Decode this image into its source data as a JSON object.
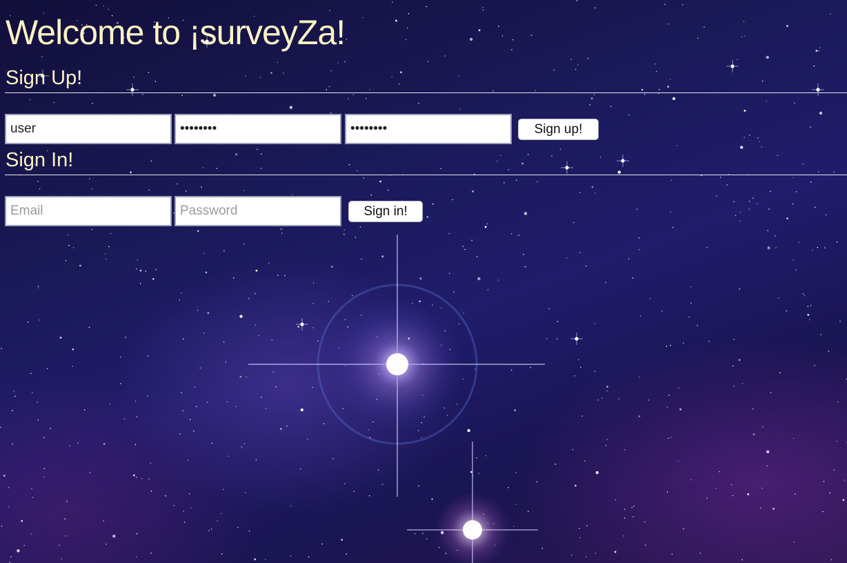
{
  "page": {
    "title": "Welcome to ¡surveyZa!"
  },
  "signup": {
    "heading": "Sign Up!",
    "username_value": "user",
    "password_value": "password",
    "confirm_value": "password",
    "button_label": "Sign up!"
  },
  "signin": {
    "heading": "Sign In!",
    "email_placeholder": "Email",
    "password_placeholder": "Password",
    "button_label": "Sign in!"
  },
  "colors": {
    "title_text": "#fbf2c4",
    "background": "#1b1a5a"
  }
}
